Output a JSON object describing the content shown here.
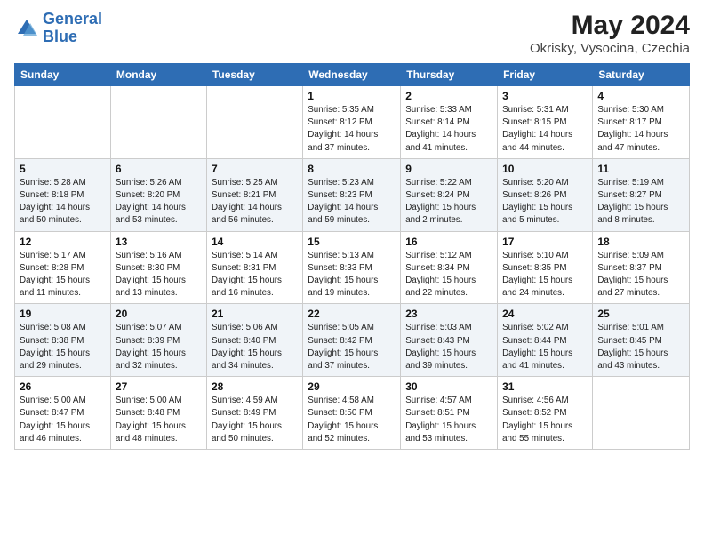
{
  "header": {
    "logo_line1": "General",
    "logo_line2": "Blue",
    "main_title": "May 2024",
    "subtitle": "Okrisky, Vysocina, Czechia"
  },
  "weekdays": [
    "Sunday",
    "Monday",
    "Tuesday",
    "Wednesday",
    "Thursday",
    "Friday",
    "Saturday"
  ],
  "weeks": [
    [
      {
        "day": "",
        "info": ""
      },
      {
        "day": "",
        "info": ""
      },
      {
        "day": "",
        "info": ""
      },
      {
        "day": "1",
        "info": "Sunrise: 5:35 AM\nSunset: 8:12 PM\nDaylight: 14 hours\nand 37 minutes."
      },
      {
        "day": "2",
        "info": "Sunrise: 5:33 AM\nSunset: 8:14 PM\nDaylight: 14 hours\nand 41 minutes."
      },
      {
        "day": "3",
        "info": "Sunrise: 5:31 AM\nSunset: 8:15 PM\nDaylight: 14 hours\nand 44 minutes."
      },
      {
        "day": "4",
        "info": "Sunrise: 5:30 AM\nSunset: 8:17 PM\nDaylight: 14 hours\nand 47 minutes."
      }
    ],
    [
      {
        "day": "5",
        "info": "Sunrise: 5:28 AM\nSunset: 8:18 PM\nDaylight: 14 hours\nand 50 minutes."
      },
      {
        "day": "6",
        "info": "Sunrise: 5:26 AM\nSunset: 8:20 PM\nDaylight: 14 hours\nand 53 minutes."
      },
      {
        "day": "7",
        "info": "Sunrise: 5:25 AM\nSunset: 8:21 PM\nDaylight: 14 hours\nand 56 minutes."
      },
      {
        "day": "8",
        "info": "Sunrise: 5:23 AM\nSunset: 8:23 PM\nDaylight: 14 hours\nand 59 minutes."
      },
      {
        "day": "9",
        "info": "Sunrise: 5:22 AM\nSunset: 8:24 PM\nDaylight: 15 hours\nand 2 minutes."
      },
      {
        "day": "10",
        "info": "Sunrise: 5:20 AM\nSunset: 8:26 PM\nDaylight: 15 hours\nand 5 minutes."
      },
      {
        "day": "11",
        "info": "Sunrise: 5:19 AM\nSunset: 8:27 PM\nDaylight: 15 hours\nand 8 minutes."
      }
    ],
    [
      {
        "day": "12",
        "info": "Sunrise: 5:17 AM\nSunset: 8:28 PM\nDaylight: 15 hours\nand 11 minutes."
      },
      {
        "day": "13",
        "info": "Sunrise: 5:16 AM\nSunset: 8:30 PM\nDaylight: 15 hours\nand 13 minutes."
      },
      {
        "day": "14",
        "info": "Sunrise: 5:14 AM\nSunset: 8:31 PM\nDaylight: 15 hours\nand 16 minutes."
      },
      {
        "day": "15",
        "info": "Sunrise: 5:13 AM\nSunset: 8:33 PM\nDaylight: 15 hours\nand 19 minutes."
      },
      {
        "day": "16",
        "info": "Sunrise: 5:12 AM\nSunset: 8:34 PM\nDaylight: 15 hours\nand 22 minutes."
      },
      {
        "day": "17",
        "info": "Sunrise: 5:10 AM\nSunset: 8:35 PM\nDaylight: 15 hours\nand 24 minutes."
      },
      {
        "day": "18",
        "info": "Sunrise: 5:09 AM\nSunset: 8:37 PM\nDaylight: 15 hours\nand 27 minutes."
      }
    ],
    [
      {
        "day": "19",
        "info": "Sunrise: 5:08 AM\nSunset: 8:38 PM\nDaylight: 15 hours\nand 29 minutes."
      },
      {
        "day": "20",
        "info": "Sunrise: 5:07 AM\nSunset: 8:39 PM\nDaylight: 15 hours\nand 32 minutes."
      },
      {
        "day": "21",
        "info": "Sunrise: 5:06 AM\nSunset: 8:40 PM\nDaylight: 15 hours\nand 34 minutes."
      },
      {
        "day": "22",
        "info": "Sunrise: 5:05 AM\nSunset: 8:42 PM\nDaylight: 15 hours\nand 37 minutes."
      },
      {
        "day": "23",
        "info": "Sunrise: 5:03 AM\nSunset: 8:43 PM\nDaylight: 15 hours\nand 39 minutes."
      },
      {
        "day": "24",
        "info": "Sunrise: 5:02 AM\nSunset: 8:44 PM\nDaylight: 15 hours\nand 41 minutes."
      },
      {
        "day": "25",
        "info": "Sunrise: 5:01 AM\nSunset: 8:45 PM\nDaylight: 15 hours\nand 43 minutes."
      }
    ],
    [
      {
        "day": "26",
        "info": "Sunrise: 5:00 AM\nSunset: 8:47 PM\nDaylight: 15 hours\nand 46 minutes."
      },
      {
        "day": "27",
        "info": "Sunrise: 5:00 AM\nSunset: 8:48 PM\nDaylight: 15 hours\nand 48 minutes."
      },
      {
        "day": "28",
        "info": "Sunrise: 4:59 AM\nSunset: 8:49 PM\nDaylight: 15 hours\nand 50 minutes."
      },
      {
        "day": "29",
        "info": "Sunrise: 4:58 AM\nSunset: 8:50 PM\nDaylight: 15 hours\nand 52 minutes."
      },
      {
        "day": "30",
        "info": "Sunrise: 4:57 AM\nSunset: 8:51 PM\nDaylight: 15 hours\nand 53 minutes."
      },
      {
        "day": "31",
        "info": "Sunrise: 4:56 AM\nSunset: 8:52 PM\nDaylight: 15 hours\nand 55 minutes."
      },
      {
        "day": "",
        "info": ""
      }
    ]
  ]
}
